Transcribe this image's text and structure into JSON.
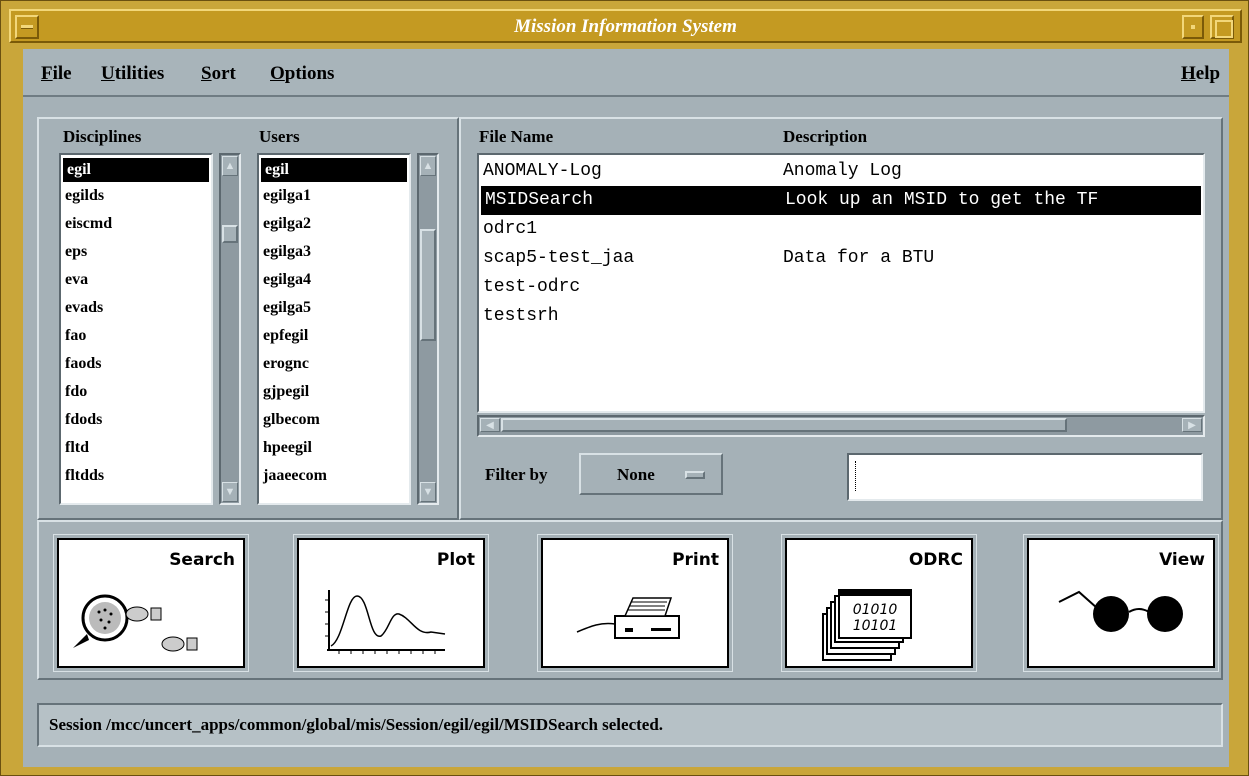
{
  "window": {
    "title": "Mission Information System"
  },
  "menubar": {
    "items": [
      {
        "label": "File",
        "mnemonic": "F"
      },
      {
        "label": "Utilities",
        "mnemonic": "U"
      },
      {
        "label": "Sort",
        "mnemonic": "S"
      },
      {
        "label": "Options",
        "mnemonic": "O"
      }
    ],
    "help": {
      "label": "Help",
      "mnemonic": "H"
    }
  },
  "disciplines": {
    "header": "Disciplines",
    "selected": "egil",
    "items": [
      "egil",
      "egilds",
      "eiscmd",
      "eps",
      "eva",
      "evads",
      "fao",
      "faods",
      "fdo",
      "fdods",
      "fltd",
      "fltdds"
    ]
  },
  "users": {
    "header": "Users",
    "selected": "egil",
    "items": [
      "egil",
      "egilga1",
      "egilga2",
      "egilga3",
      "egilga4",
      "egilga5",
      "epfegil",
      "erognc",
      "gjpegil",
      "glbecom",
      "hpeegil",
      "jaaeecom"
    ]
  },
  "files": {
    "header_name": "File Name",
    "header_desc": "Description",
    "selected": "MSIDSearch",
    "rows": [
      {
        "name": "ANOMALY-Log",
        "desc": "Anomaly Log"
      },
      {
        "name": "MSIDSearch",
        "desc": "Look up an MSID to get the TF"
      },
      {
        "name": "odrc1",
        "desc": ""
      },
      {
        "name": "scap5-test_jaa",
        "desc": "Data for a BTU"
      },
      {
        "name": "test-odrc",
        "desc": ""
      },
      {
        "name": "testsrh",
        "desc": ""
      }
    ]
  },
  "filter": {
    "label": "Filter by",
    "value": "None",
    "text": ""
  },
  "actions": [
    {
      "label": "Search",
      "icon": "magnifier-footprints-icon"
    },
    {
      "label": "Plot",
      "icon": "line-plot-icon"
    },
    {
      "label": "Print",
      "icon": "printer-icon"
    },
    {
      "label": "ODRC",
      "icon": "binary-documents-icon"
    },
    {
      "label": "View",
      "icon": "eyeglasses-icon"
    }
  ],
  "status": {
    "text": "Session /mcc/uncert_apps/common/global/mis/Session/egil/egil/MSIDSearch selected."
  },
  "colors": {
    "frame": "#c9a63a",
    "title_text": "#ffffff",
    "panel": "#a5b1b7",
    "selection": "#000000"
  }
}
